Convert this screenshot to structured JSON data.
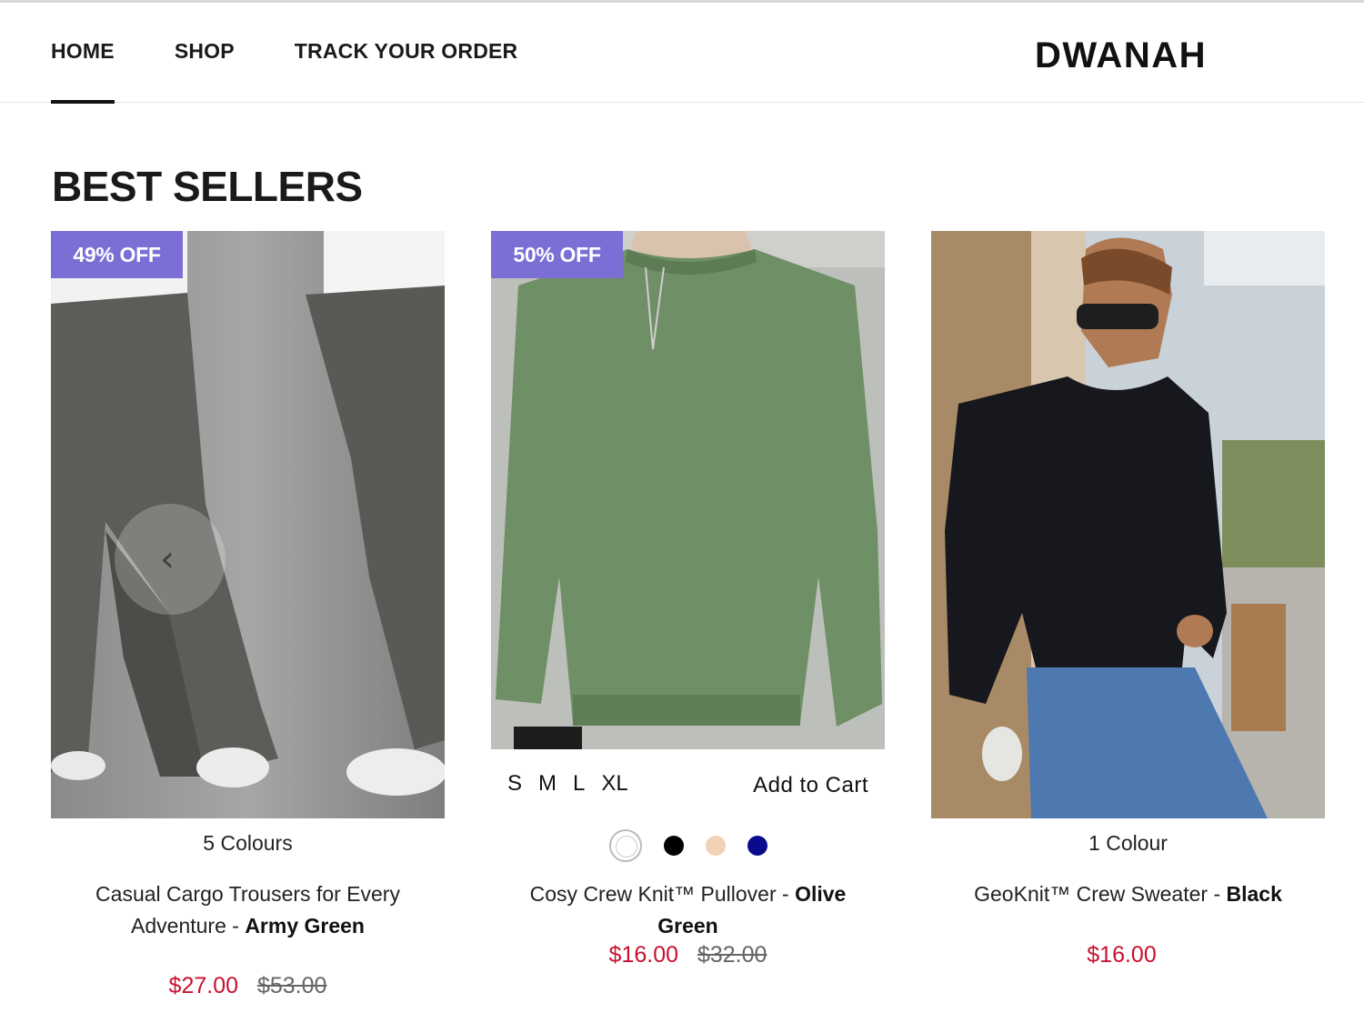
{
  "nav": {
    "items": [
      {
        "label": "HOME",
        "active": true
      },
      {
        "label": "SHOP",
        "active": false
      },
      {
        "label": "TRACK YOUR ORDER",
        "active": false
      }
    ],
    "brand": "DWANAH"
  },
  "section": {
    "title": "BEST SELLERS"
  },
  "theme": {
    "badge_color": "#7b6fd6",
    "sale_price_color": "#c8102e"
  },
  "products": [
    {
      "badge": "49% OFF",
      "image": "model-wearing-grey-cargo-trousers",
      "colour_count": "5 Colours",
      "name": "Casual Cargo Trousers for Every Adventure - ",
      "variant": "Army Green",
      "price": "$27.00",
      "original_price": "$53.00"
    },
    {
      "badge": "50% OFF",
      "image": "model-wearing-olive-green-knit-pullover",
      "sizes": [
        "S",
        "M",
        "L",
        "XL"
      ],
      "add_to_cart": "Add to Cart",
      "swatches": [
        "#ffffff",
        "#000000",
        "#f2d2b6",
        "#0a0a8f"
      ],
      "name": "Cosy Crew Knit™ Pullover - ",
      "variant": "Olive Green",
      "price": "$16.00",
      "original_price": "$32.00"
    },
    {
      "image": "model-wearing-black-cable-knit-sweater",
      "colour_count": "1 Colour",
      "name": "GeoKnit™ Crew Sweater - ",
      "variant": "Black",
      "price": "$16.00"
    }
  ]
}
